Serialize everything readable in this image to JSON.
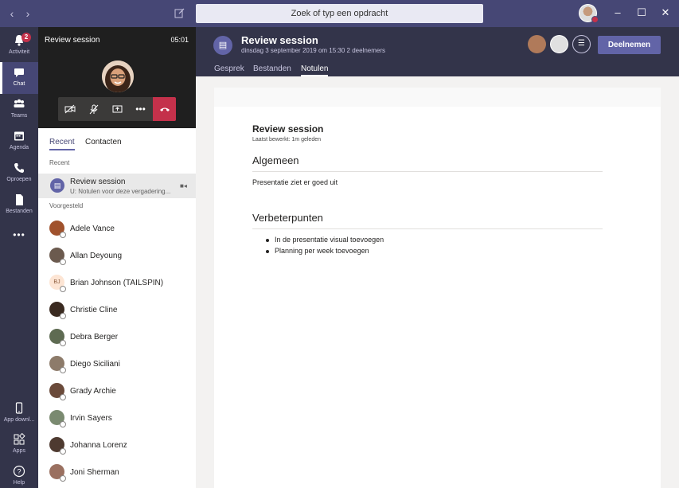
{
  "titlebar": {
    "search_placeholder": "Zoek of typ een opdracht",
    "back_icon": "‹",
    "forward_icon": "›",
    "minimize": "–",
    "maximize": "☐",
    "close": "✕"
  },
  "rail": {
    "items": [
      {
        "label": "Activiteit",
        "icon": "bell-icon",
        "badge": "2"
      },
      {
        "label": "Chat",
        "icon": "chat-icon"
      },
      {
        "label": "Teams",
        "icon": "teams-icon"
      },
      {
        "label": "Agenda",
        "icon": "calendar-icon"
      },
      {
        "label": "Oproepen",
        "icon": "phone-icon"
      },
      {
        "label": "Bestanden",
        "icon": "file-icon"
      },
      {
        "label": "App downl...",
        "icon": "mobile-icon"
      },
      {
        "label": "Apps",
        "icon": "apps-icon"
      },
      {
        "label": "Help",
        "icon": "help-icon"
      }
    ],
    "more": "•••"
  },
  "call": {
    "title": "Review session",
    "time": "05:01",
    "more": "•••"
  },
  "panel": {
    "tabs": [
      "Recent",
      "Contacten"
    ],
    "recent_label": "Recent",
    "suggested_label": "Voorgesteld",
    "recent_item": {
      "title": "Review session",
      "subtitle": "U: Notulen voor deze vergadering..."
    },
    "contacts": [
      {
        "name": "Adele Vance"
      },
      {
        "name": "Allan Deyoung"
      },
      {
        "name": "Brian Johnson (TAILSPIN)",
        "initials": "BJ"
      },
      {
        "name": "Christie Cline"
      },
      {
        "name": "Debra Berger"
      },
      {
        "name": "Diego Siciliani"
      },
      {
        "name": "Grady Archie"
      },
      {
        "name": "Irvin Sayers"
      },
      {
        "name": "Johanna Lorenz"
      },
      {
        "name": "Joni Sherman"
      }
    ]
  },
  "header": {
    "title": "Review session",
    "subtitle": "dinsdag 3 september 2019 om 15:30 2 deelnemers",
    "tabs": [
      "Gesprek",
      "Bestanden",
      "Notulen"
    ],
    "join_label": "Deelnemen"
  },
  "notes": {
    "title": "Review session",
    "last_edited": "Laatst bewerkt: 1m geleden",
    "section1_heading": "Algemeen",
    "section1_text": "Presentatie ziet er goed uit",
    "section2_heading": "Verbeterpunten",
    "section2_items": [
      "In de presentatie visual toevoegen",
      "Planning per week toevoegen"
    ]
  },
  "colors": {
    "titlebar": "#464775",
    "rail": "#33344a",
    "accent": "#6264a7",
    "end_call": "#c4314b"
  }
}
